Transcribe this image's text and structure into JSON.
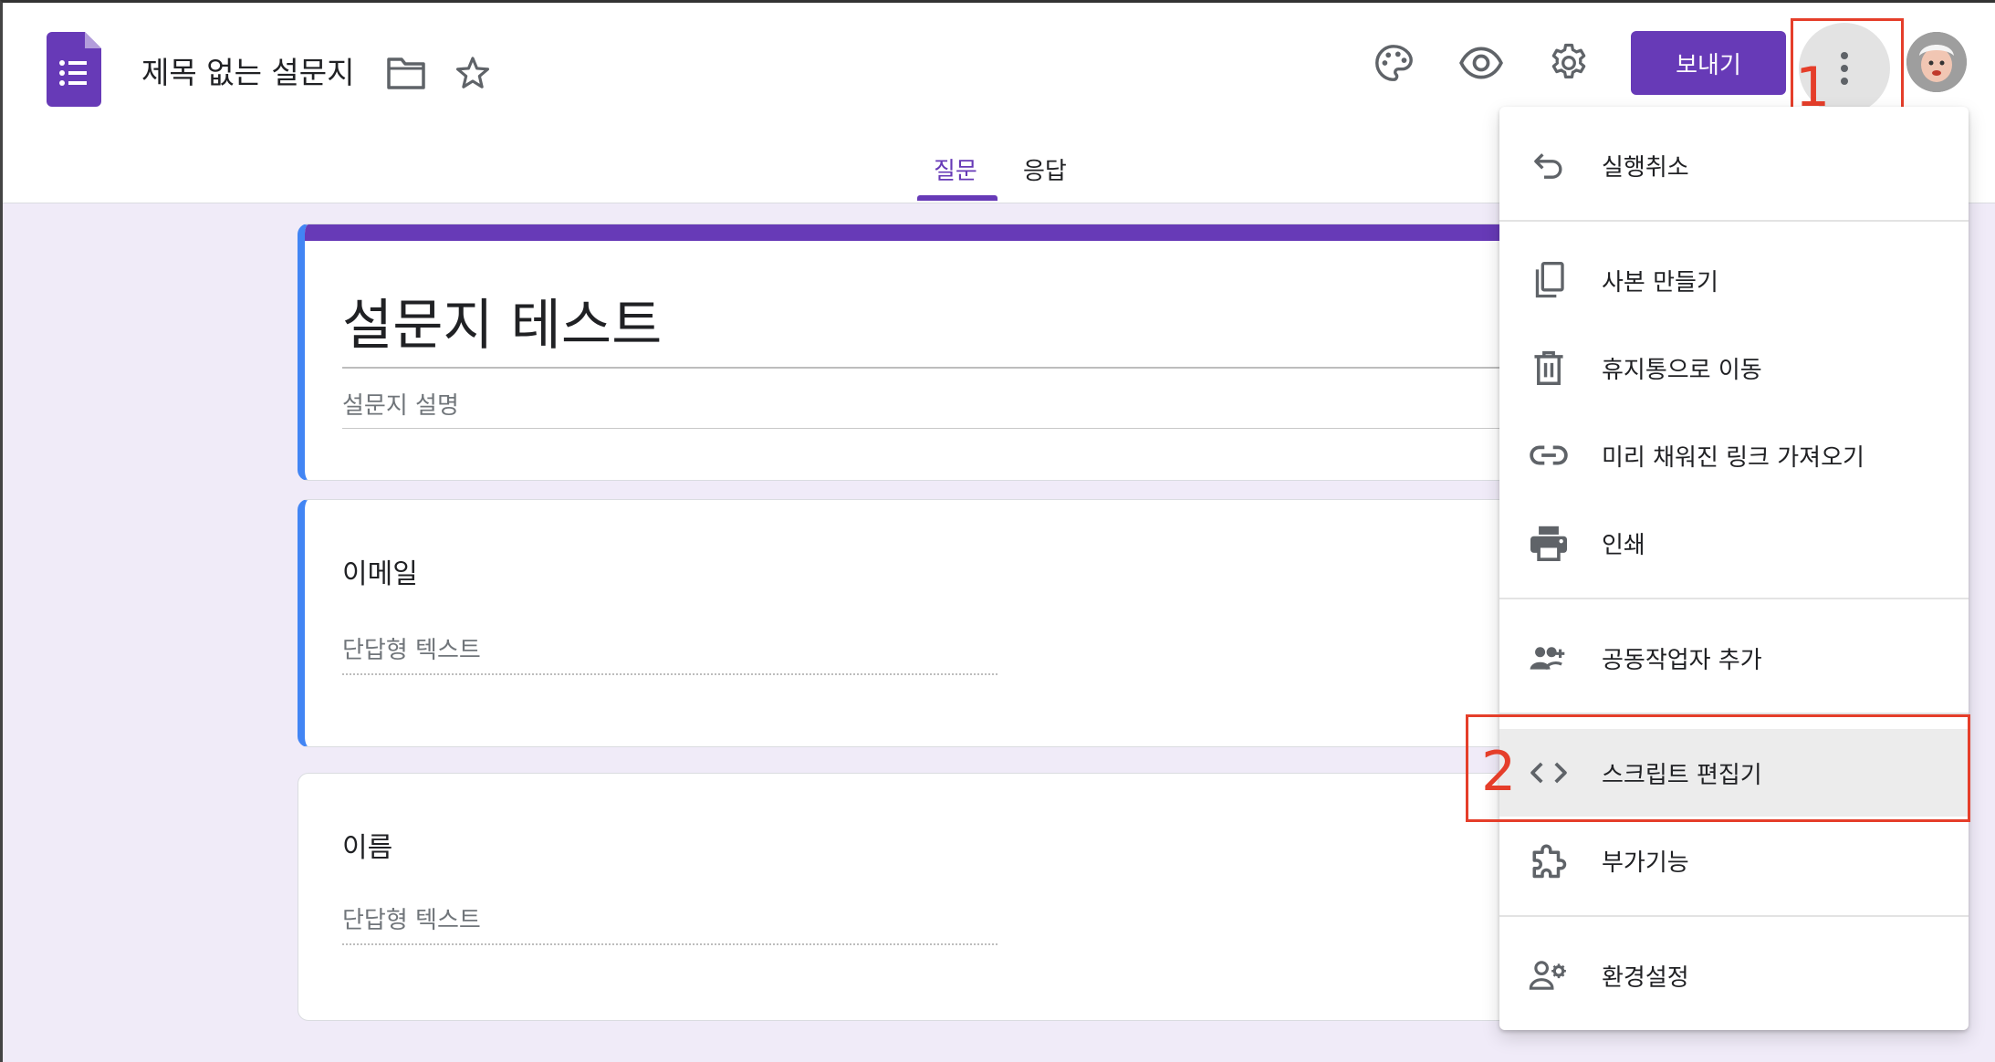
{
  "header": {
    "doc_title": "제목 없는 설문지",
    "send_label": "보내기",
    "icons": [
      "forms-logo-icon",
      "folder-icon",
      "star-icon",
      "palette-icon",
      "eye-icon",
      "gear-icon",
      "more-vert-icon"
    ]
  },
  "tabs": {
    "questions": "질문",
    "responses": "응답"
  },
  "form": {
    "title": "설문지 테스트",
    "description_placeholder": "설문지 설명",
    "questions": [
      {
        "title": "이메일",
        "answer_placeholder": "단답형 텍스트"
      },
      {
        "title": "이름",
        "answer_placeholder": "단답형 텍스트"
      }
    ]
  },
  "menu": {
    "items": [
      {
        "label": "실행취소",
        "icon": "undo-icon"
      },
      {
        "label": "사본 만들기",
        "icon": "copy-icon"
      },
      {
        "label": "휴지통으로 이동",
        "icon": "trash-icon"
      },
      {
        "label": "미리 채워진 링크 가져오기",
        "icon": "link-icon"
      },
      {
        "label": "인쇄",
        "icon": "print-icon"
      },
      {
        "label": "공동작업자 추가",
        "icon": "add-people-icon"
      },
      {
        "label": "스크립트 편집기",
        "icon": "code-icon"
      },
      {
        "label": "부가기능",
        "icon": "puzzle-icon"
      },
      {
        "label": "환경설정",
        "icon": "person-settings-icon"
      }
    ]
  },
  "annotations": {
    "step1": "1",
    "step2": "2",
    "color": "#e53e2a"
  },
  "colors": {
    "accent": "#673ab7",
    "active_border": "#4285f4",
    "background": "#f0ebf8"
  }
}
